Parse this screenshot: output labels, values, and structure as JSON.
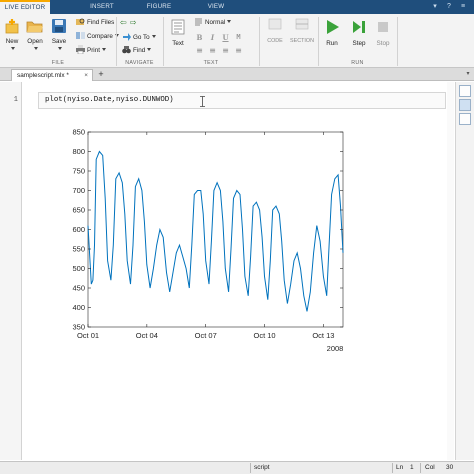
{
  "ribbon_tabs": [
    {
      "label": "LIVE EDITOR",
      "active": true
    },
    {
      "label": "INSERT",
      "active": false
    },
    {
      "label": "FIGURE",
      "active": false
    },
    {
      "label": "VIEW",
      "active": false
    }
  ],
  "ribbon": {
    "new": "New",
    "open": "Open",
    "save": "Save",
    "find_files": "Find Files",
    "compare": "Compare",
    "print": "Print",
    "go_to": "Go To",
    "find": "Find",
    "text": "Text",
    "style_select": "Normal",
    "code": "CODE",
    "section": "SECTION",
    "run": "Run",
    "step": "Step",
    "stop": "Stop",
    "groups": {
      "file": "FILE",
      "navigate": "NAVIGATE",
      "text": "TEXT",
      "run": "RUN"
    }
  },
  "editor": {
    "file_tab": "samplescript.mlx *",
    "close_glyph": "×",
    "add_tab_glyph": "+",
    "line_number": "1",
    "code": "plot(nyiso.Date,nyiso.DUNWOD)"
  },
  "status": {
    "mode": "script",
    "ln_label": "Ln",
    "ln_value": "1",
    "col_label": "Col",
    "col_value": "30"
  },
  "colors": {
    "tabbar": "#1f4e7c",
    "accent": "#f7a800",
    "line": "#0072bd",
    "run_green": "#3aa23a"
  },
  "chart_data": {
    "type": "line",
    "title": "",
    "xlabel": "",
    "ylabel": "",
    "x_ticks": [
      "Oct 01",
      "Oct 04",
      "Oct 07",
      "Oct 10",
      "Oct 13"
    ],
    "x_secondary_label": "2008",
    "xlim": [
      "2008-10-01",
      "2008-10-14"
    ],
    "y_ticks": [
      350,
      400,
      450,
      500,
      550,
      600,
      650,
      700,
      750,
      800,
      850
    ],
    "ylim": [
      350,
      850
    ],
    "grid": false,
    "legend": "none",
    "series": [
      {
        "x": [
          "2008-10-01T00:00",
          "2008-10-01T04:00",
          "2008-10-01T06:00",
          "2008-10-01T08:00",
          "2008-10-01T10:00",
          "2008-10-01T14:00",
          "2008-10-01T18:00",
          "2008-10-01T21:00",
          "2008-10-02T00:00",
          "2008-10-02T04:00",
          "2008-10-02T07:00",
          "2008-10-02T10:00",
          "2008-10-02T14:00",
          "2008-10-02T18:00",
          "2008-10-02T21:00",
          "2008-10-03T00:00",
          "2008-10-03T04:00",
          "2008-10-03T07:00",
          "2008-10-03T10:00",
          "2008-10-03T14:00",
          "2008-10-03T18:00",
          "2008-10-03T21:00",
          "2008-10-04T00:00",
          "2008-10-04T04:00",
          "2008-10-04T08:00",
          "2008-10-04T12:00",
          "2008-10-04T16:00",
          "2008-10-04T20:00",
          "2008-10-05T00:00",
          "2008-10-05T04:00",
          "2008-10-05T08:00",
          "2008-10-05T12:00",
          "2008-10-05T16:00",
          "2008-10-05T20:00",
          "2008-10-06T00:00",
          "2008-10-06T04:00",
          "2008-10-06T07:00",
          "2008-10-06T10:00",
          "2008-10-06T14:00",
          "2008-10-06T18:00",
          "2008-10-06T21:00",
          "2008-10-07T00:00",
          "2008-10-07T04:00",
          "2008-10-07T07:00",
          "2008-10-07T10:00",
          "2008-10-07T14:00",
          "2008-10-07T18:00",
          "2008-10-07T21:00",
          "2008-10-08T00:00",
          "2008-10-08T04:00",
          "2008-10-08T07:00",
          "2008-10-08T10:00",
          "2008-10-08T14:00",
          "2008-10-08T18:00",
          "2008-10-08T21:00",
          "2008-10-09T00:00",
          "2008-10-09T04:00",
          "2008-10-09T07:00",
          "2008-10-09T10:00",
          "2008-10-09T14:00",
          "2008-10-09T18:00",
          "2008-10-09T21:00",
          "2008-10-10T00:00",
          "2008-10-10T04:00",
          "2008-10-10T07:00",
          "2008-10-10T10:00",
          "2008-10-10T14:00",
          "2008-10-10T18:00",
          "2008-10-10T21:00",
          "2008-10-11T00:00",
          "2008-10-11T04:00",
          "2008-10-11T08:00",
          "2008-10-11T12:00",
          "2008-10-11T16:00",
          "2008-10-11T20:00",
          "2008-10-12T00:00",
          "2008-10-12T04:00",
          "2008-10-12T08:00",
          "2008-10-12T12:00",
          "2008-10-12T16:00",
          "2008-10-12T20:00",
          "2008-10-13T00:00",
          "2008-10-13T04:00",
          "2008-10-13T07:00",
          "2008-10-13T10:00",
          "2008-10-13T14:00",
          "2008-10-13T18:00",
          "2008-10-13T21:00",
          "2008-10-14T00:00"
        ],
        "y": [
          610,
          460,
          470,
          560,
          780,
          800,
          790,
          680,
          520,
          470,
          560,
          730,
          745,
          720,
          640,
          520,
          460,
          560,
          710,
          730,
          700,
          620,
          510,
          450,
          500,
          560,
          600,
          580,
          490,
          440,
          490,
          540,
          560,
          530,
          500,
          450,
          560,
          690,
          700,
          700,
          640,
          520,
          460,
          570,
          700,
          720,
          700,
          620,
          500,
          440,
          550,
          680,
          700,
          690,
          600,
          480,
          430,
          530,
          660,
          670,
          650,
          580,
          480,
          420,
          520,
          650,
          660,
          640,
          570,
          470,
          410,
          460,
          520,
          540,
          500,
          430,
          390,
          440,
          540,
          610,
          570,
          480,
          430,
          560,
          690,
          730,
          740,
          660,
          540
        ]
      }
    ]
  }
}
